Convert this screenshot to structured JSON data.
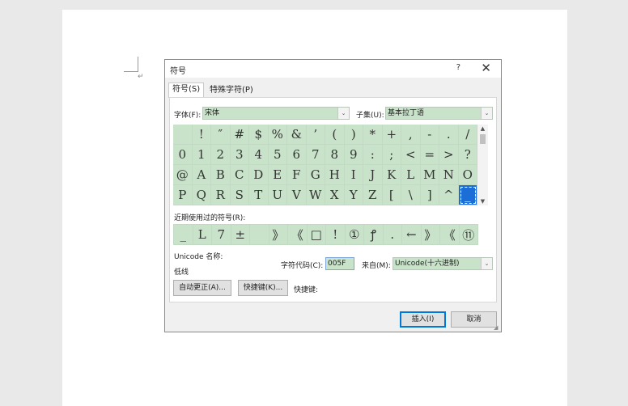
{
  "dialog": {
    "title": "符号",
    "help": "?",
    "close": "✕"
  },
  "tabs": [
    {
      "label": "符号(S)"
    },
    {
      "label": "特殊字符(P)"
    }
  ],
  "font": {
    "label": "字体(F):",
    "value": "宋体"
  },
  "subset": {
    "label": "子集(U):",
    "value": "基本拉丁语"
  },
  "symbols": [
    " ",
    "!",
    "″",
    "#",
    "$",
    "%",
    "&",
    "’",
    "(",
    ")",
    "*",
    "+",
    ",",
    "-",
    ".",
    "/",
    "0",
    "1",
    "2",
    "3",
    "4",
    "5",
    "6",
    "7",
    "8",
    "9",
    ":",
    ";",
    "<",
    "=",
    ">",
    "?",
    "@",
    "A",
    "B",
    "C",
    "D",
    "E",
    "F",
    "G",
    "H",
    "I",
    "J",
    "K",
    "L",
    "M",
    "N",
    "O",
    "P",
    "Q",
    "R",
    "S",
    "T",
    "U",
    "V",
    "W",
    "X",
    "Y",
    "Z",
    "[",
    "\\",
    "]",
    "^",
    "_"
  ],
  "recent": {
    "label": "近期使用过的符号(R):",
    "items": [
      "_",
      "L",
      "7",
      "±",
      "",
      "》",
      "《",
      "□",
      "!",
      "①",
      "ꝭ",
      ".",
      "←",
      "》",
      "《",
      "⑪"
    ]
  },
  "unicode": {
    "name_label": "Unicode 名称:",
    "name_value": "低线",
    "code_label": "字符代码(C):",
    "code_value": "005F",
    "from_label": "来自(M):",
    "from_value": "Unicode(十六进制)"
  },
  "buttons": {
    "autocorrect": "自动更正(A)...",
    "shortcut_key": "快捷键(K)...",
    "shortcut_label": "快捷键:",
    "insert": "插入(I)",
    "cancel": "取消"
  },
  "colors": {
    "cell_bg": "#c8e3c9",
    "selected_bg": "#1b6ed6"
  }
}
